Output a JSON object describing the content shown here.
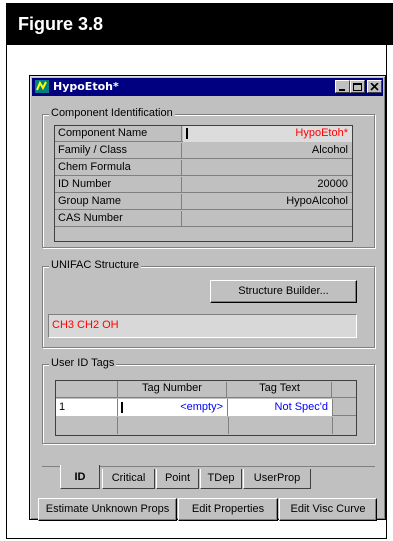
{
  "figure": {
    "label": "Figure 3.8"
  },
  "window": {
    "title": "HypoEtoh*",
    "controls": {
      "minimize": "minimize-icon",
      "maximize": "maximize-icon",
      "close": "close-icon"
    }
  },
  "component_id": {
    "group_label": "Component Identification",
    "rows": [
      {
        "label": "Component Name",
        "value": "HypoEtoh*"
      },
      {
        "label": "Family / Class",
        "value": "Alcohol"
      },
      {
        "label": "Chem Formula",
        "value": ""
      },
      {
        "label": "ID Number",
        "value": "20000"
      },
      {
        "label": "Group Name",
        "value": "HypoAlcohol"
      },
      {
        "label": "CAS Number",
        "value": ""
      }
    ]
  },
  "unifac": {
    "group_label": "UNIFAC Structure",
    "button": "Structure Builder...",
    "structure": "CH3 CH2 OH"
  },
  "user_tags": {
    "group_label": "User ID Tags",
    "columns": [
      "Tag Number",
      "Tag Text"
    ],
    "rows": [
      {
        "index": "1",
        "tag_number": "<empty>",
        "tag_text": "Not Spec'd"
      }
    ]
  },
  "tabs": [
    "ID",
    "Critical",
    "Point",
    "TDep",
    "UserProp"
  ],
  "active_tab": "ID",
  "footer_buttons": {
    "estimate": "Estimate Unknown Props",
    "edit_properties": "Edit Properties",
    "edit_visc": "Edit Visc Curve"
  },
  "colors": {
    "title_bar": "#000080",
    "highlight": "#ff0000",
    "link": "#0000ff",
    "face": "#c0c0c0"
  }
}
